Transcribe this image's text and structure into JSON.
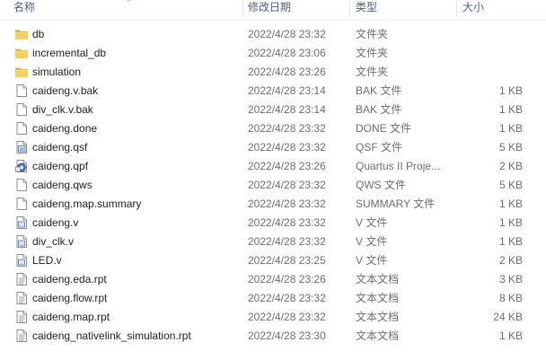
{
  "columns": {
    "name": "名称",
    "date": "修改日期",
    "type": "类型",
    "size": "大小"
  },
  "files": [
    {
      "name": "db",
      "date": "2022/4/28 23:32",
      "type": "文件夹",
      "size": "",
      "icon": "folder-icon"
    },
    {
      "name": "incremental_db",
      "date": "2022/4/28 23:06",
      "type": "文件夹",
      "size": "",
      "icon": "folder-icon"
    },
    {
      "name": "simulation",
      "date": "2022/4/28 23:26",
      "type": "文件夹",
      "size": "",
      "icon": "folder-icon"
    },
    {
      "name": "caideng.v.bak",
      "date": "2022/4/28 23:14",
      "type": "BAK 文件",
      "size": "1 KB",
      "icon": "file-icon"
    },
    {
      "name": "div_clk.v.bak",
      "date": "2022/4/28 23:14",
      "type": "BAK 文件",
      "size": "1 KB",
      "icon": "file-icon"
    },
    {
      "name": "caideng.done",
      "date": "2022/4/28 23:32",
      "type": "DONE 文件",
      "size": "1 KB",
      "icon": "file-icon"
    },
    {
      "name": "caideng.qsf",
      "date": "2022/4/28 23:32",
      "type": "QSF 文件",
      "size": "5 KB",
      "icon": "qsf-file-icon"
    },
    {
      "name": "caideng.qpf",
      "date": "2022/4/28 23:26",
      "type": "Quartus II Proje...",
      "size": "2 KB",
      "icon": "quartus-project-icon"
    },
    {
      "name": "caideng.qws",
      "date": "2022/4/28 23:32",
      "type": "QWS 文件",
      "size": "5 KB",
      "icon": "file-icon"
    },
    {
      "name": "caideng.map.summary",
      "date": "2022/4/28 23:32",
      "type": "SUMMARY 文件",
      "size": "1 KB",
      "icon": "file-icon"
    },
    {
      "name": "caideng.v",
      "date": "2022/4/28 23:32",
      "type": "V 文件",
      "size": "1 KB",
      "icon": "verilog-file-icon"
    },
    {
      "name": "div_clk.v",
      "date": "2022/4/28 23:32",
      "type": "V 文件",
      "size": "1 KB",
      "icon": "verilog-file-icon"
    },
    {
      "name": "LED.v",
      "date": "2022/4/28 23:25",
      "type": "V 文件",
      "size": "2 KB",
      "icon": "verilog-file-icon"
    },
    {
      "name": "caideng.eda.rpt",
      "date": "2022/4/28 23:26",
      "type": "文本文档",
      "size": "3 KB",
      "icon": "text-file-icon"
    },
    {
      "name": "caideng.flow.rpt",
      "date": "2022/4/28 23:32",
      "type": "文本文档",
      "size": "8 KB",
      "icon": "text-file-icon"
    },
    {
      "name": "caideng.map.rpt",
      "date": "2022/4/28 23:32",
      "type": "文本文档",
      "size": "24 KB",
      "icon": "text-file-icon"
    },
    {
      "name": "caideng_nativelink_simulation.rpt",
      "date": "2022/4/28 23:30",
      "type": "文本文档",
      "size": "1 KB",
      "icon": "text-file-icon"
    }
  ],
  "colors": {
    "header_text": "#4c607a",
    "name_text": "#1e1e1e",
    "detail_text": "#6d6d6d",
    "folder_yellow": "#f0c24b",
    "hover_bg": "#e5f3ff"
  }
}
